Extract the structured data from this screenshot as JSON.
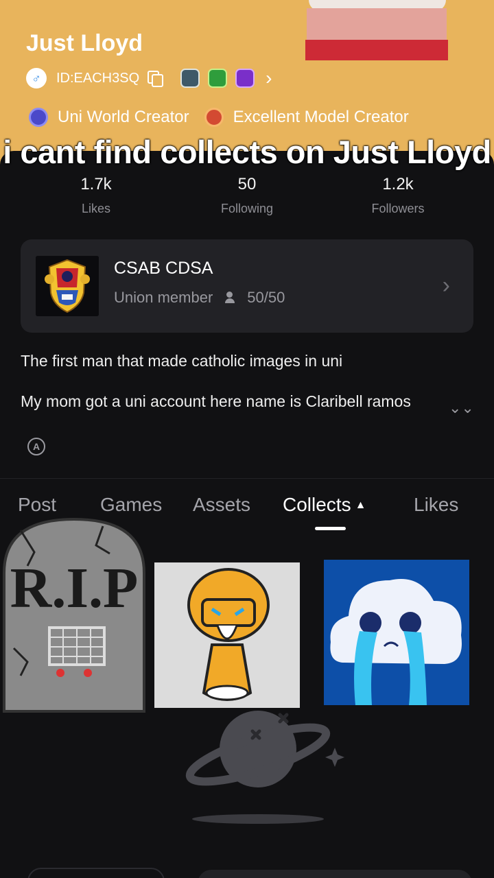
{
  "profile": {
    "username": "Just Lloyd",
    "gender_symbol": "♂",
    "id_text": "ID:EACH3SQ",
    "chevron": "›",
    "titles": [
      "Uni World Creator",
      "Excellent Model Creator"
    ]
  },
  "caption": "i cant find collects on Just Lloyd",
  "stats": {
    "likes_value": "1.7k",
    "likes_label": "Likes",
    "following_value": "50",
    "following_label": "Following",
    "followers_value": "1.2k",
    "followers_label": "Followers"
  },
  "union": {
    "name": "CSAB CDSA",
    "role": "Union member",
    "members": "50/50",
    "chevron": "›"
  },
  "bio": {
    "line1": "The first man that made catholic images in uni",
    "line2": "My mom got a uni account here name is Claribell ramos",
    "expand_glyph": "⌄⌄",
    "translate_glyph": "A"
  },
  "tabs": {
    "posts": "Post",
    "games": "Games",
    "assets": "Assets",
    "collects": "Collects",
    "collects_caret": "▲",
    "likes": "Likes",
    "active": "collects"
  },
  "sticker_rip_text": "R.I.P",
  "colors": {
    "header_bg": "#e8b45c",
    "sheet_bg": "#111113",
    "card_bg": "#222226",
    "muted_text": "#8f8f95"
  }
}
